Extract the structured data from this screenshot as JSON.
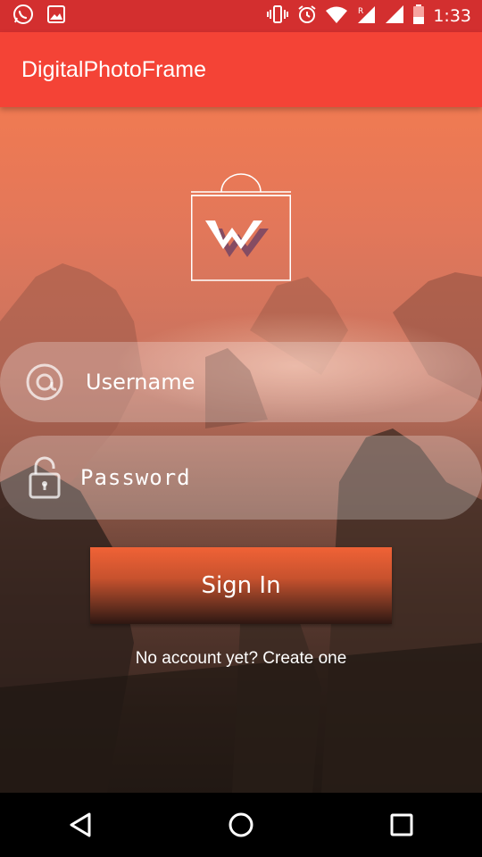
{
  "status_bar": {
    "time": "1:33",
    "icons_left": [
      "whatsapp-icon",
      "image-icon"
    ],
    "icons_right": [
      "vibrate-icon",
      "alarm-icon",
      "wifi-icon",
      "signal-roaming-icon",
      "signal-icon",
      "battery-icon"
    ]
  },
  "app": {
    "title": "DigitalPhotoFrame",
    "accent": "#f44336",
    "status_color": "#d32f2f"
  },
  "form": {
    "username_placeholder": "Username",
    "password_placeholder": "Password",
    "signin_label": "Sign In",
    "create_account_text": "No account yet? Create one"
  },
  "logo": {
    "letter": "W"
  }
}
